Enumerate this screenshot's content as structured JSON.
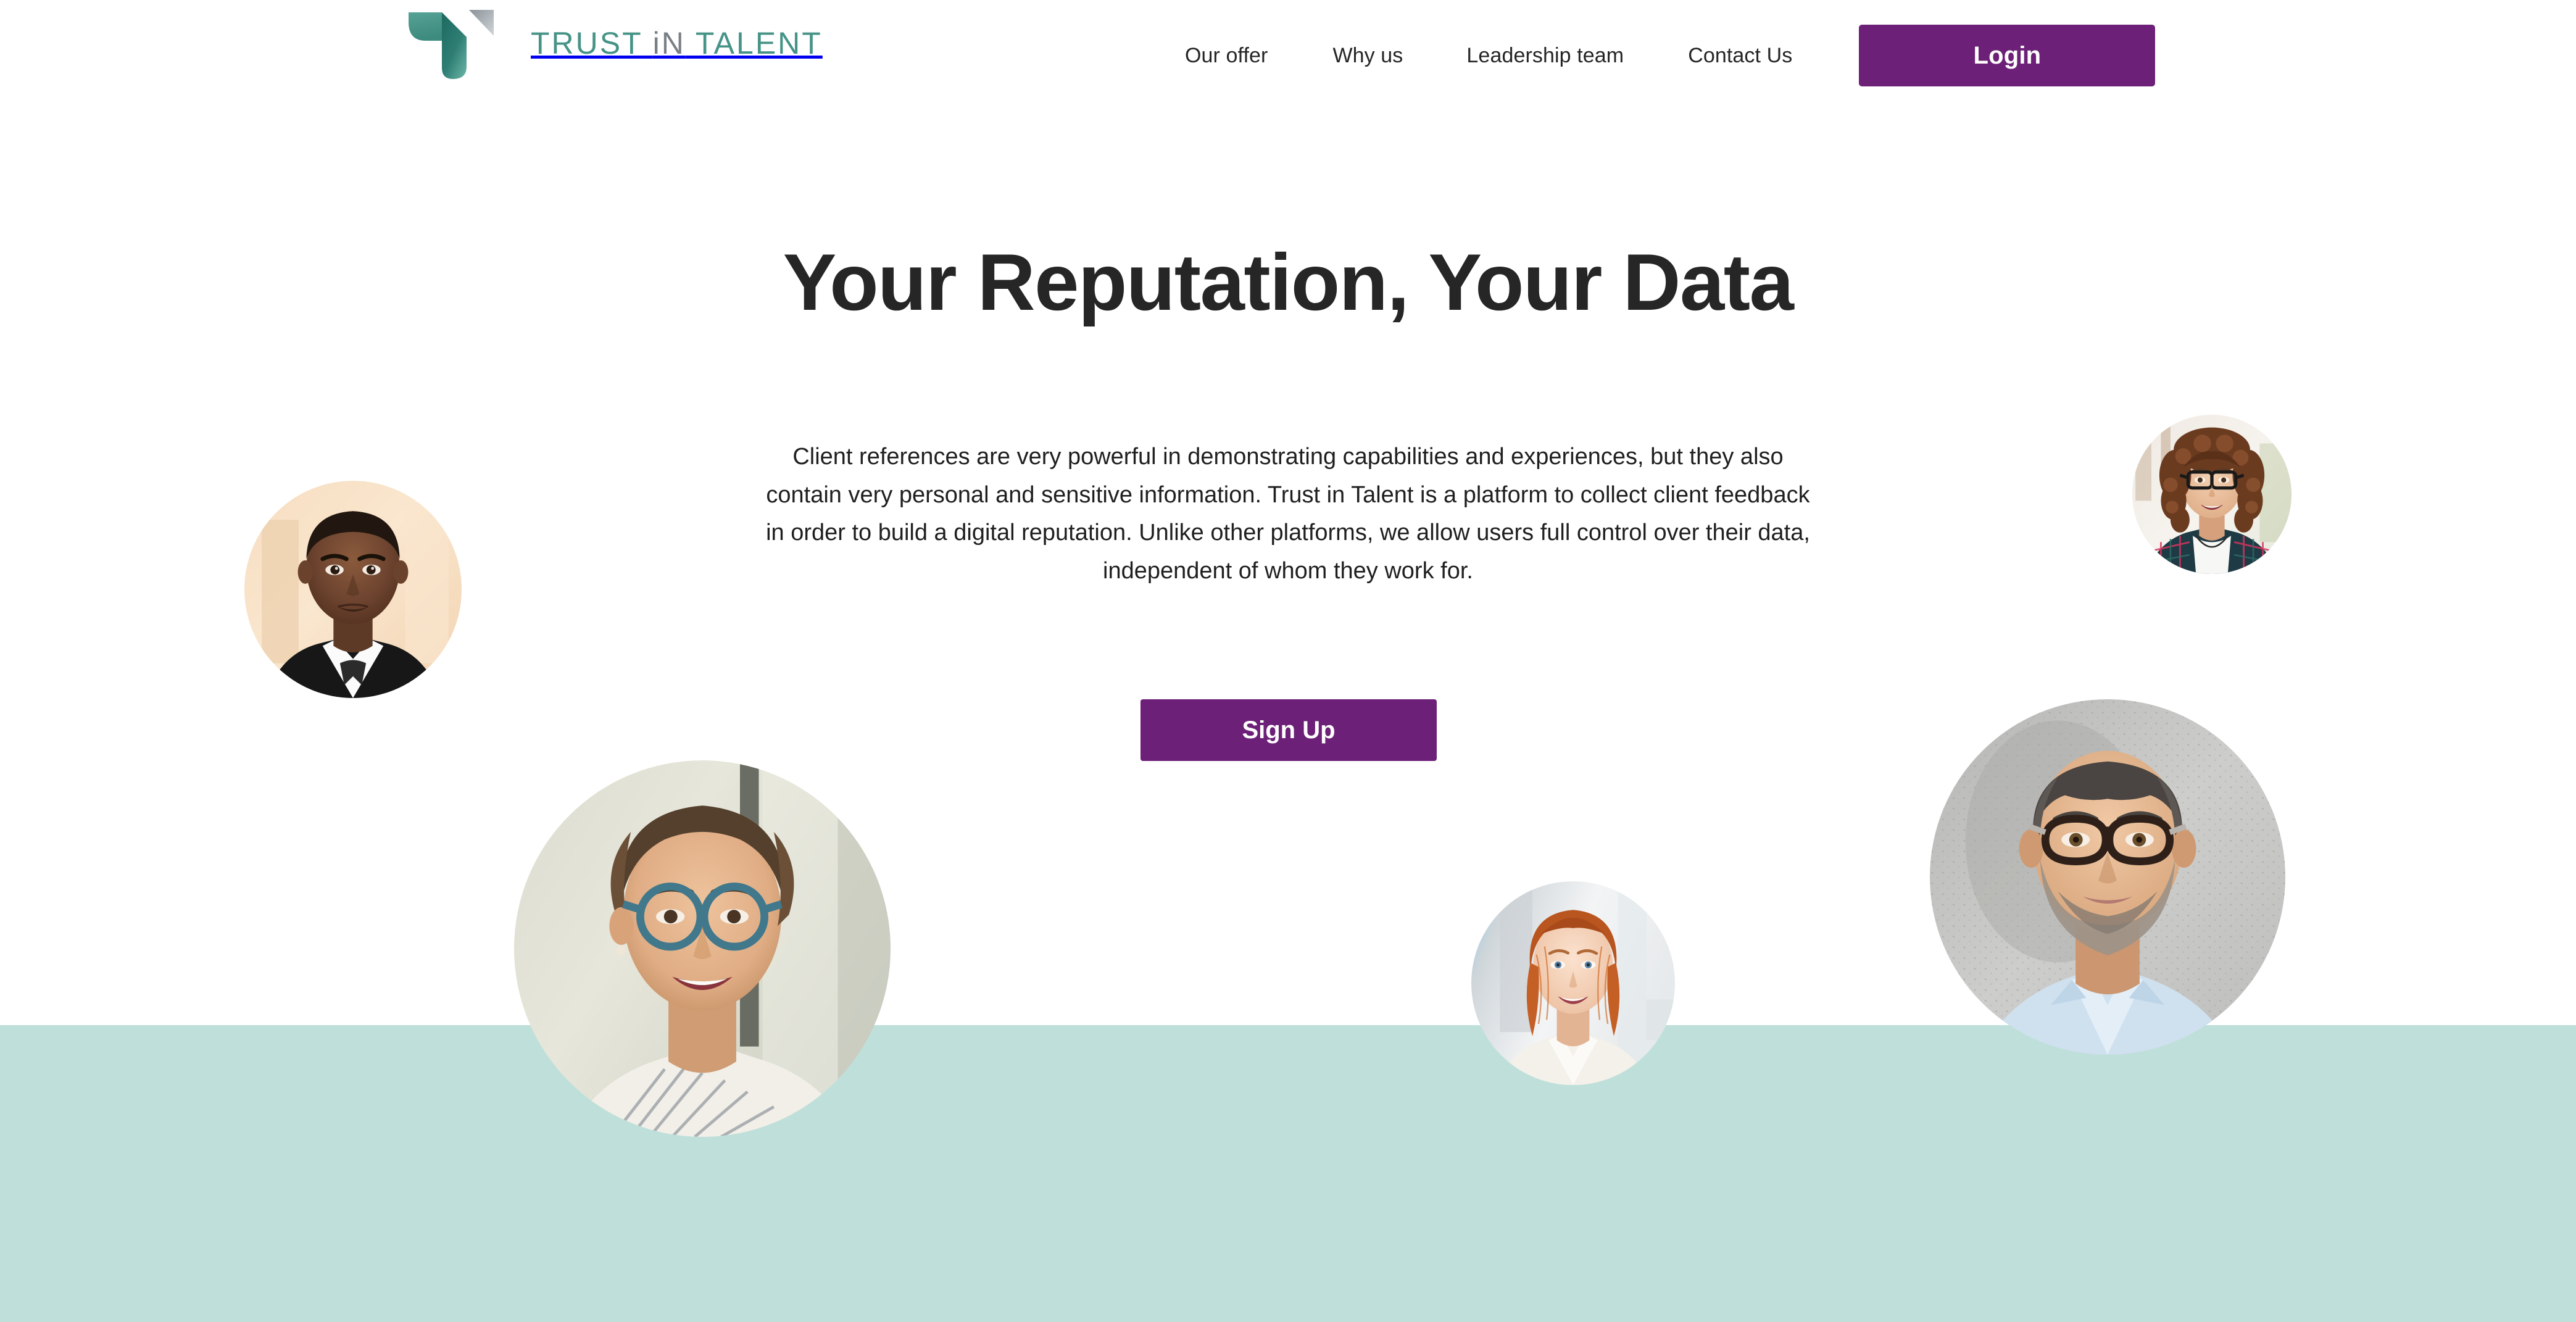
{
  "brand": {
    "logo_icon": "trust-in-talent-logo-mark",
    "word_part_1": "TRUST ",
    "word_part_2": "iN",
    "word_part_3": " TALENT",
    "teal": "#479387",
    "gray": "#798085"
  },
  "nav": {
    "items": [
      {
        "label": "Our offer"
      },
      {
        "label": "Why us"
      },
      {
        "label": "Leadership team"
      },
      {
        "label": "Contact Us"
      }
    ],
    "login_label": "Login",
    "login_color": "#6c2077"
  },
  "hero": {
    "title": "Your Reputation, Your Data",
    "paragraph": "Client references are very powerful in demonstrating capabilities and experiences, but they also contain very personal and sensitive information. Trust in Talent is a platform to collect client feedback in order to build a digital reputation. Unlike other platforms, we allow users full control over their data, independent of whom they work for.",
    "cta_label": "Sign Up",
    "cta_color": "#6c2077"
  },
  "section": {
    "band_color": "#bfe0da"
  },
  "portraits": [
    {
      "name": "portrait-man-suit",
      "alt": "Smiling man in a dark suit and bow tie"
    },
    {
      "name": "portrait-woman-curly-glasses",
      "alt": "Smiling woman with curly hair and black glasses"
    },
    {
      "name": "portrait-woman-blue-glasses",
      "alt": "Smiling woman with blue round glasses"
    },
    {
      "name": "portrait-woman-red-hair",
      "alt": "Smiling woman with red hair in a white blazer"
    },
    {
      "name": "portrait-man-glasses-beard",
      "alt": "Smiling man with glasses and grey beard in a light blue shirt"
    }
  ]
}
